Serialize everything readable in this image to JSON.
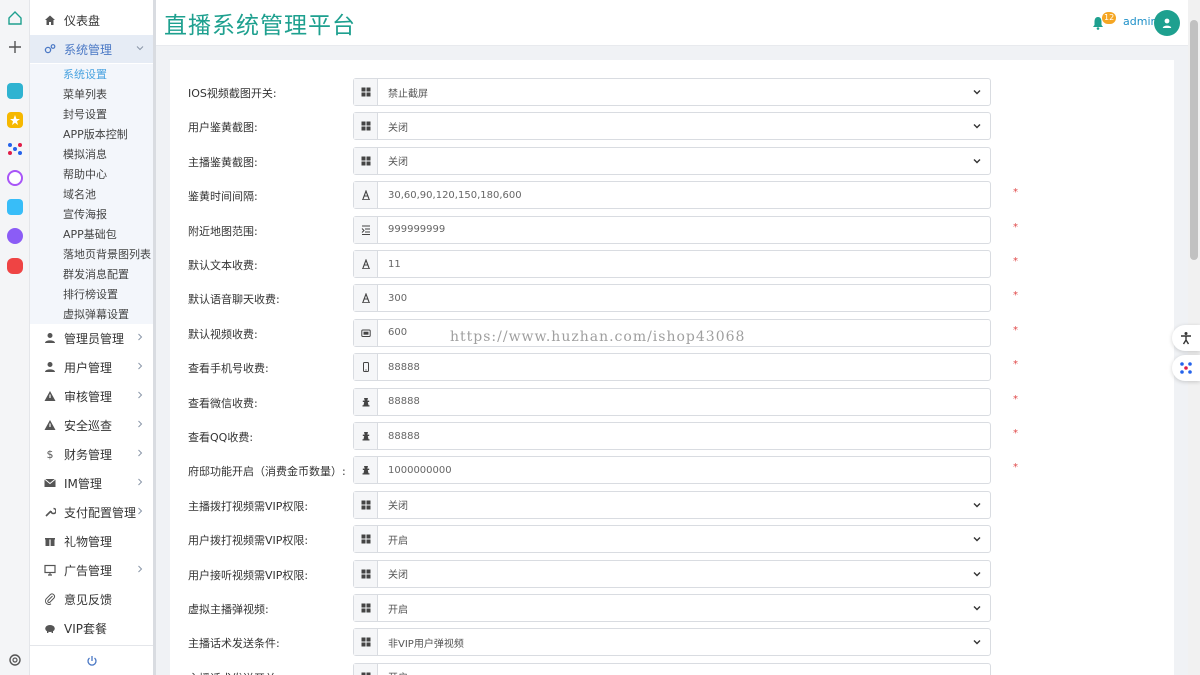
{
  "header": {
    "title": "直播系统管理平台",
    "notification_count": "12",
    "username": "admin"
  },
  "sidebar": {
    "items": [
      {
        "label": "仪表盘",
        "icon": "home-icon",
        "expanded": false,
        "active": false
      },
      {
        "label": "系统管理",
        "icon": "cogs-icon",
        "expanded": true,
        "active": true,
        "children": [
          "系统设置",
          "菜单列表",
          "封号设置",
          "APP版本控制",
          "模拟消息",
          "帮助中心",
          "域名池",
          "宣传海报",
          "APP基础包",
          "落地页背景图列表",
          "群发消息配置",
          "排行榜设置",
          "虚拟弹幕设置"
        ],
        "active_child": "系统设置"
      },
      {
        "label": "管理员管理",
        "icon": "user-icon"
      },
      {
        "label": "用户管理",
        "icon": "user-icon"
      },
      {
        "label": "审核管理",
        "icon": "warning-icon"
      },
      {
        "label": "安全巡查",
        "icon": "warning-icon"
      },
      {
        "label": "财务管理",
        "icon": "dollar-icon"
      },
      {
        "label": "IM管理",
        "icon": "mail-icon"
      },
      {
        "label": "支付配置管理",
        "icon": "wrench-icon"
      },
      {
        "label": "礼物管理",
        "icon": "gift-icon"
      },
      {
        "label": "广告管理",
        "icon": "monitor-icon"
      },
      {
        "label": "意见反馈",
        "icon": "paperclip-icon"
      },
      {
        "label": "VIP套餐",
        "icon": "piggy-bank-icon"
      }
    ]
  },
  "form": {
    "rows": [
      {
        "label": "IOS视频截图开关:",
        "type": "select",
        "value": "禁止截屏",
        "icon": "grid-icon",
        "required": false
      },
      {
        "label": "用户鉴黄截图:",
        "type": "select",
        "value": "关闭",
        "icon": "grid-icon",
        "required": false
      },
      {
        "label": "主播鉴黄截图:",
        "type": "select",
        "value": "关闭",
        "icon": "grid-icon",
        "required": false
      },
      {
        "label": "鉴黄时间间隔:",
        "type": "input",
        "value": "30,60,90,120,150,180,600",
        "icon": "text-icon",
        "required": true
      },
      {
        "label": "附近地图范围:",
        "type": "input",
        "value": "999999999",
        "icon": "indent-icon",
        "required": true
      },
      {
        "label": "默认文本收费:",
        "type": "input",
        "value": "11",
        "icon": "text-icon",
        "required": true
      },
      {
        "label": "默认语音聊天收费:",
        "type": "input",
        "value": "300",
        "icon": "text-icon",
        "required": true
      },
      {
        "label": "默认视频收费:",
        "type": "input",
        "value": "600",
        "icon": "video-icon",
        "required": true
      },
      {
        "label": "查看手机号收费:",
        "type": "input",
        "value": "88888",
        "icon": "phone-icon",
        "required": true
      },
      {
        "label": "查看微信收费:",
        "type": "input",
        "value": "88888",
        "icon": "chess-icon",
        "required": true
      },
      {
        "label": "查看QQ收费:",
        "type": "input",
        "value": "88888",
        "icon": "chess-icon",
        "required": true
      },
      {
        "label": "府邸功能开启（消费金币数量）:",
        "type": "input",
        "value": "1000000000",
        "icon": "chess-icon",
        "required": true
      },
      {
        "label": "主播拨打视频需VIP权限:",
        "type": "select",
        "value": "关闭",
        "icon": "grid-icon",
        "required": false
      },
      {
        "label": "用户拨打视频需VIP权限:",
        "type": "select",
        "value": "开启",
        "icon": "grid-icon",
        "required": false
      },
      {
        "label": "用户接听视频需VIP权限:",
        "type": "select",
        "value": "关闭",
        "icon": "grid-icon",
        "required": false
      },
      {
        "label": "虚拟主播弹视频:",
        "type": "select",
        "value": "开启",
        "icon": "grid-icon",
        "required": false
      },
      {
        "label": "主播话术发送条件:",
        "type": "select",
        "value": "非VIP用户弹视频",
        "icon": "grid-icon",
        "required": false
      },
      {
        "label": "主播话术发送开关:",
        "type": "select",
        "value": "开启",
        "icon": "grid-icon",
        "required": false
      }
    ],
    "required_mark": "*"
  },
  "watermark": "https://www.huzhan.com/ishop43068",
  "colors": {
    "title": "#1ea08f",
    "accent": "#4a78c5",
    "submenu_active": "#4aa3e0",
    "required": "#e04848",
    "badge": "#f5a623"
  }
}
